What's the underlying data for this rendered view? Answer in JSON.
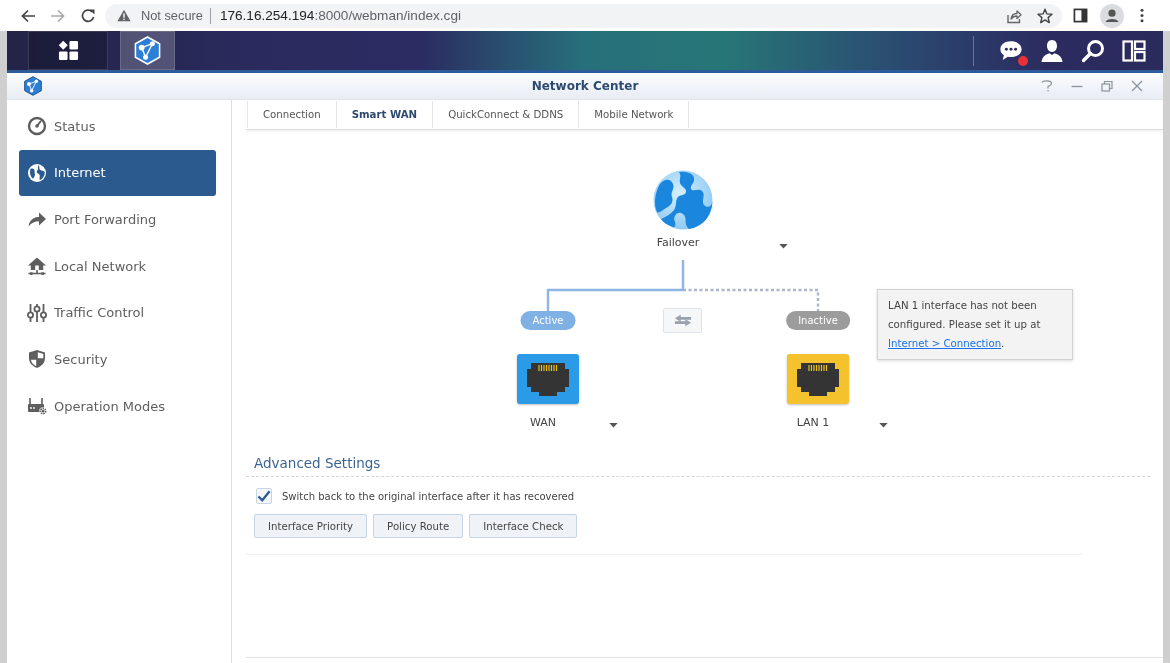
{
  "browser": {
    "forward_disabled": true,
    "security_label": "Not secure",
    "url_host": "176.16.254.194",
    "url_path": ":8000/webman/index.cgi"
  },
  "taskbar": {
    "unread_notifications": true
  },
  "window": {
    "title": "Network Center"
  },
  "sidebar": {
    "items": [
      {
        "label": "Status",
        "selected": false
      },
      {
        "label": "Internet",
        "selected": true
      },
      {
        "label": "Port Forwarding",
        "selected": false
      },
      {
        "label": "Local Network",
        "selected": false
      },
      {
        "label": "Traffic Control",
        "selected": false
      },
      {
        "label": "Security",
        "selected": false
      },
      {
        "label": "Operation Modes",
        "selected": false
      }
    ]
  },
  "tabs": [
    {
      "label": "Connection",
      "selected": false
    },
    {
      "label": "Smart WAN",
      "selected": true
    },
    {
      "label": "QuickConnect & DDNS",
      "selected": false
    },
    {
      "label": "Mobile Network",
      "selected": false
    }
  ],
  "diagram": {
    "mode": "Failover",
    "interfaces": [
      {
        "label": "WAN",
        "status": "Active",
        "active": true,
        "configured": true
      },
      {
        "label": "LAN 1",
        "status": "Inactive",
        "active": false,
        "configured": false
      }
    ],
    "tooltip": {
      "text": "LAN 1 interface has not been configured. Please set it up at",
      "link": "Internet > Connection",
      "text_after": "."
    }
  },
  "advanced_settings": {
    "heading": "Advanced Settings",
    "switch_back": {
      "label": "Switch back to the original interface after it has recovered",
      "checked": true
    },
    "buttons": [
      "Interface Priority",
      "Policy Route",
      "Interface Check"
    ]
  }
}
